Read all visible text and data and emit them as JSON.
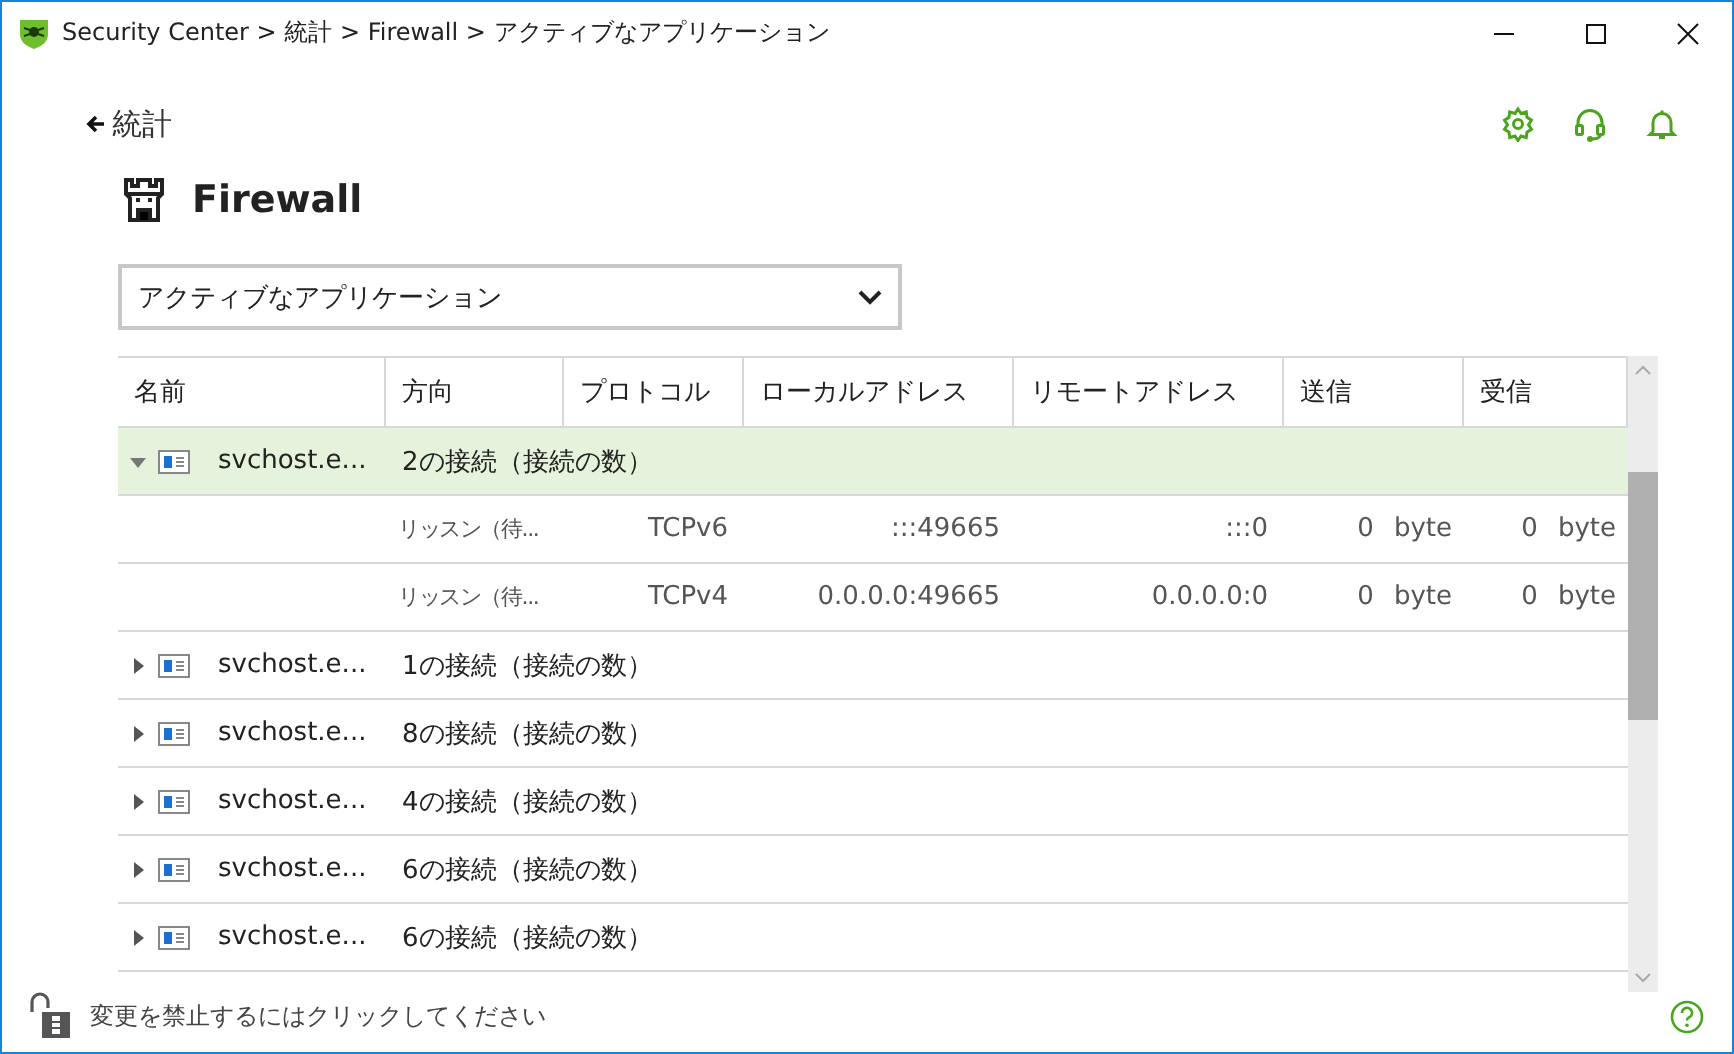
{
  "window": {
    "title": "Security Center > 統計 > Firewall > アクティブなアプリケーション"
  },
  "back": {
    "label": "統計"
  },
  "heading": "Firewall",
  "view_select": {
    "value": "アクティブなアプリケーション"
  },
  "table": {
    "columns": [
      "名前",
      "方向",
      "プロトコル",
      "ローカルアドレス",
      "リモートアドレス",
      "送信",
      "受信"
    ],
    "rows": [
      {
        "name": "svchost.e...",
        "summary": "2の接続（接続の数）",
        "expanded": true,
        "selected": true,
        "children": [
          {
            "direction": "リッスン（待...",
            "protocol": "TCPv6",
            "local": ":::49665",
            "remote": ":::0",
            "sent": "0",
            "sent_unit": "byte",
            "received": "0",
            "received_unit": "byte"
          },
          {
            "direction": "リッスン（待...",
            "protocol": "TCPv4",
            "local": "0.0.0.0:49665",
            "remote": "0.0.0.0:0",
            "sent": "0",
            "sent_unit": "byte",
            "received": "0",
            "received_unit": "byte"
          }
        ]
      },
      {
        "name": "svchost.e...",
        "summary": "1の接続（接続の数）",
        "expanded": false,
        "selected": false
      },
      {
        "name": "svchost.e...",
        "summary": "8の接続（接続の数）",
        "expanded": false,
        "selected": false
      },
      {
        "name": "svchost.e...",
        "summary": "4の接続（接続の数）",
        "expanded": false,
        "selected": false
      },
      {
        "name": "svchost.e...",
        "summary": "6の接続（接続の数）",
        "expanded": false,
        "selected": false
      },
      {
        "name": "svchost.e...",
        "summary": "6の接続（接続の数）",
        "expanded": false,
        "selected": false
      }
    ]
  },
  "footer": {
    "lock_hint": "変更を禁止するにはクリックしてください"
  }
}
